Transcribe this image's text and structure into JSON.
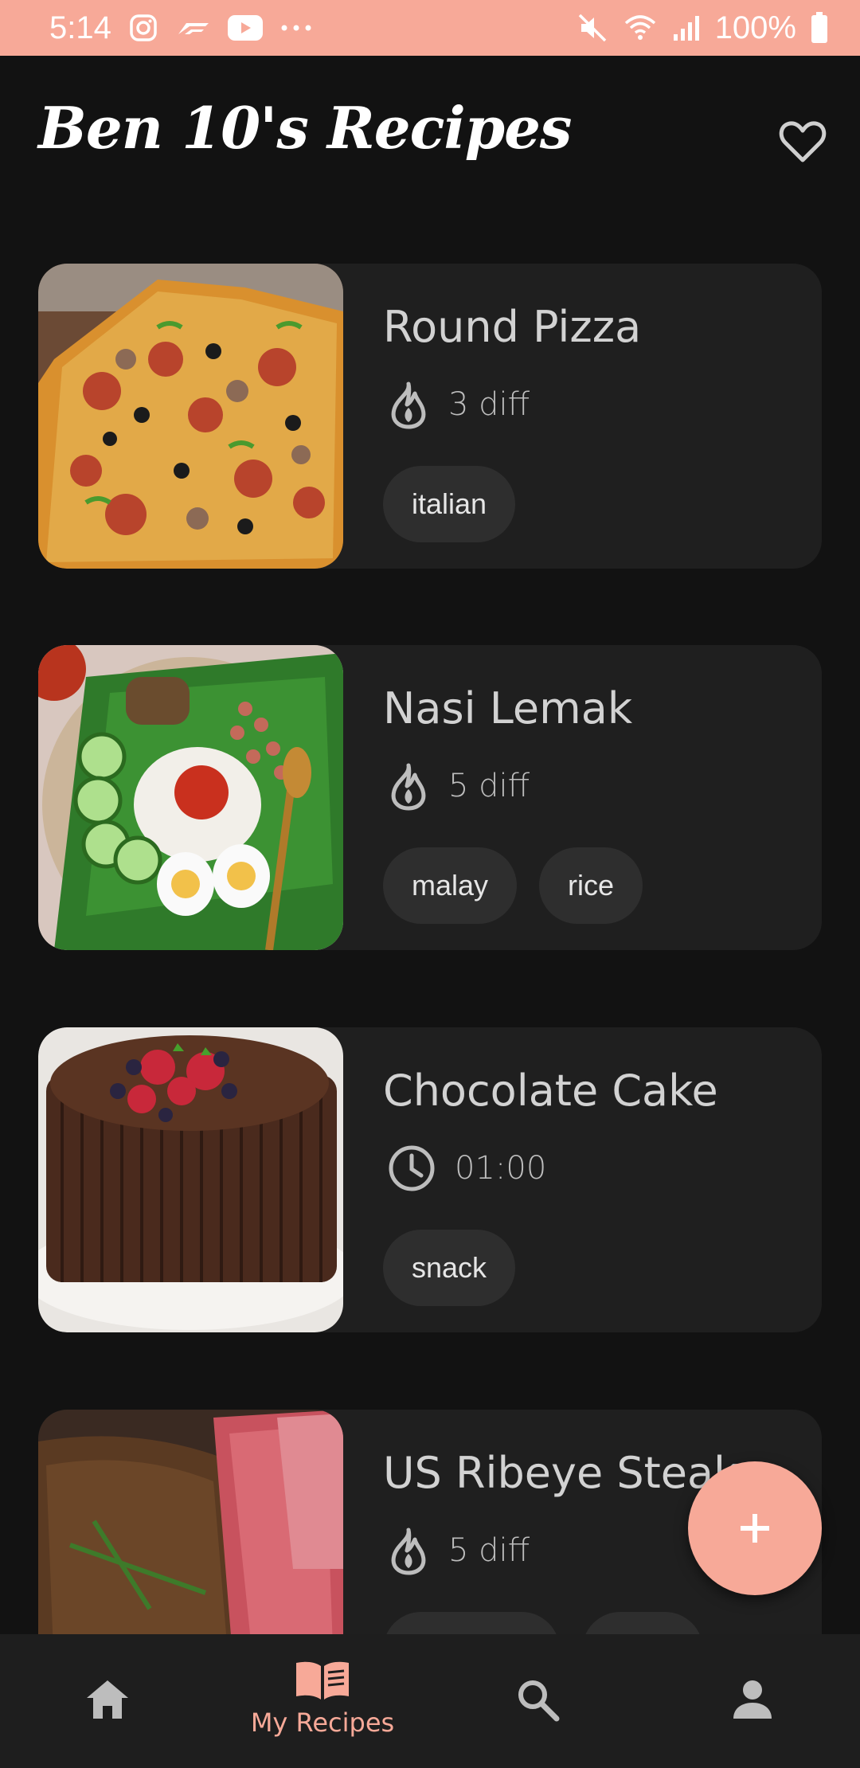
{
  "status_bar": {
    "time": "5:14",
    "battery": "100%"
  },
  "header": {
    "title": "Ben 10's Recipes",
    "favorite_icon": "heart-outline-icon"
  },
  "recipes": [
    {
      "title": "Round Pizza",
      "meta_icon": "flame-icon",
      "meta": "3 diff",
      "tags": [
        "italian"
      ]
    },
    {
      "title": "Nasi Lemak",
      "meta_icon": "flame-icon",
      "meta": "5 diff",
      "tags": [
        "malay",
        "rice"
      ]
    },
    {
      "title": "Chocolate Cake",
      "meta_icon": "clock-icon",
      "meta": "01:00",
      "tags": [
        "snack"
      ]
    },
    {
      "title": "US Ribeye Steak",
      "meta_icon": "flame-icon",
      "meta": "5 diff",
      "tags": [
        "",
        ""
      ]
    }
  ],
  "fab": {
    "icon": "plus-icon"
  },
  "bottom_nav": {
    "items": [
      {
        "icon": "home-icon",
        "label": ""
      },
      {
        "icon": "book-icon",
        "label": "My Recipes",
        "active": true
      },
      {
        "icon": "search-icon",
        "label": ""
      },
      {
        "icon": "person-icon",
        "label": ""
      }
    ]
  },
  "colors": {
    "accent": "#f7a998",
    "background": "#121212",
    "card": "#1f1f1f",
    "tag": "#2e2e2e"
  }
}
